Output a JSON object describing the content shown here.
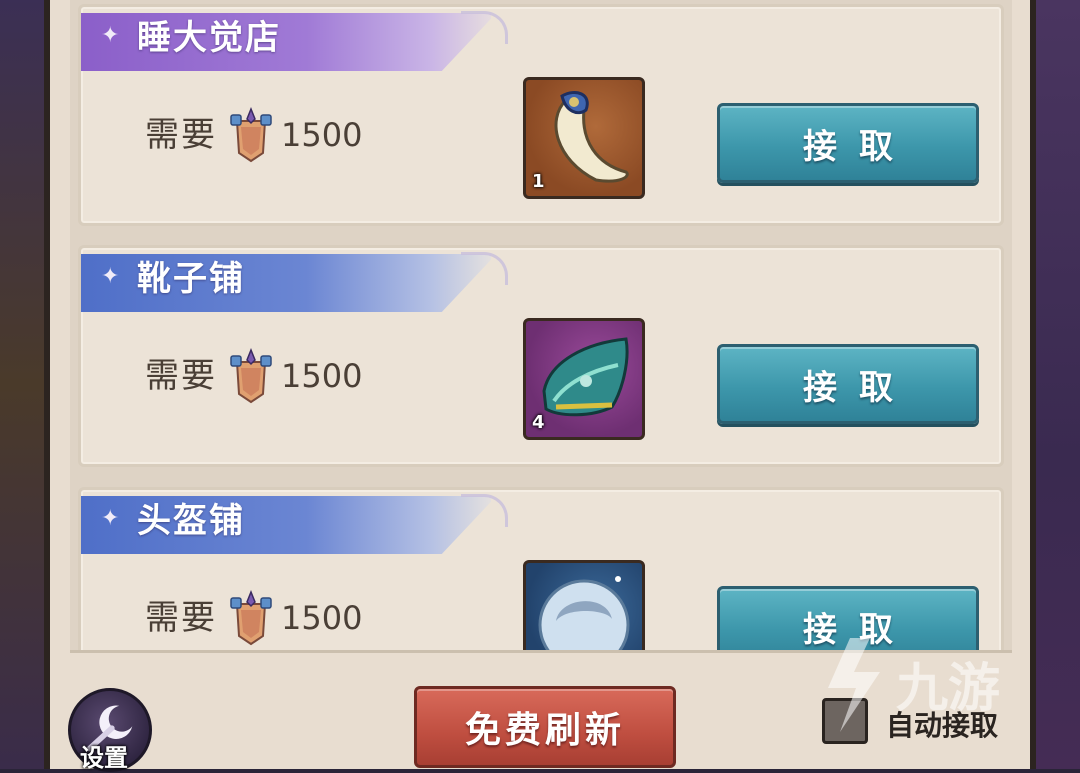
{
  "shops": [
    {
      "name": "睡大觉店",
      "need_label": "需要",
      "cost": "1500",
      "item_count": "1",
      "accept_label": "接取",
      "banner_color": "#8b5fc9",
      "slot_color": "#8b4a24"
    },
    {
      "name": "靴子铺",
      "need_label": "需要",
      "cost": "1500",
      "item_count": "4",
      "accept_label": "接取",
      "banner_color": "#4f6fc8",
      "slot_color": "#6e2f72"
    },
    {
      "name": "头盔铺",
      "need_label": "需要",
      "cost": "1500",
      "item_count": "",
      "accept_label": "接取",
      "banner_color": "#4f6fc8",
      "slot_color": "#22436c"
    }
  ],
  "footer": {
    "settings_label": "设置",
    "refresh_label": "免费刷新",
    "auto_accept_label": "自动接取"
  },
  "watermark": {
    "text": "九游"
  },
  "colors": {
    "accept_button": "#3d97ab",
    "refresh_button": "#bf4e40",
    "panel_bg": "#e8ddd0"
  }
}
